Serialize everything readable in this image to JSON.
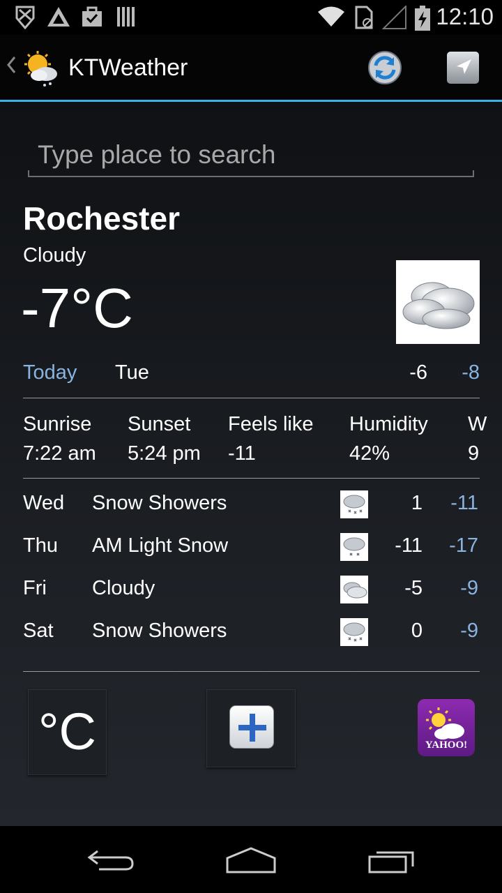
{
  "status_bar": {
    "time": "12:10"
  },
  "action_bar": {
    "title": "KTWeather"
  },
  "search": {
    "placeholder": "Type place to search",
    "value": ""
  },
  "current": {
    "city": "Rochester",
    "condition": "Cloudy",
    "temperature": "-7°C",
    "today_label": "Today",
    "today_day": "Tue",
    "today_high": "-6",
    "today_low": "-8"
  },
  "details": {
    "sunrise": {
      "label": "Sunrise",
      "value": "7:22 am"
    },
    "sunset": {
      "label": "Sunset",
      "value": "5:24 pm"
    },
    "feels_like": {
      "label": "Feels like",
      "value": "-11"
    },
    "humidity": {
      "label": "Humidity",
      "value": "42%"
    },
    "wind": {
      "label": "W",
      "value": "9"
    }
  },
  "forecast": [
    {
      "day": "Wed",
      "desc": "Snow Showers",
      "high": "1",
      "low": "-11",
      "icon": "snow-showers-icon"
    },
    {
      "day": "Thu",
      "desc": "AM Light Snow",
      "high": "-11",
      "low": "-17",
      "icon": "light-snow-icon"
    },
    {
      "day": "Fri",
      "desc": "Cloudy",
      "high": "-5",
      "low": "-9",
      "icon": "cloudy-icon"
    },
    {
      "day": "Sat",
      "desc": "Snow Showers",
      "high": "0",
      "low": "-9",
      "icon": "snow-showers-icon"
    }
  ],
  "bottom": {
    "unit_label": "°C",
    "yahoo_text": "YAHOO!"
  },
  "colors": {
    "accent": "#33b5e5",
    "low_temp": "#8ab4e0",
    "yahoo_purple": "#7b22a3"
  }
}
